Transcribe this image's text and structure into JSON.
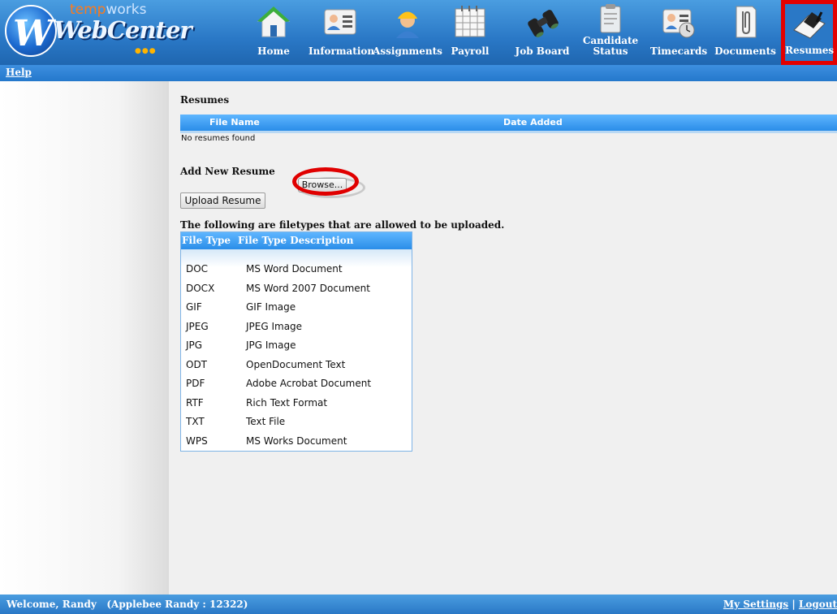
{
  "logo": {
    "brand_top_a": "temp",
    "brand_top_b": "works",
    "brand_main": "WebCenter",
    "badge": "W"
  },
  "nav": [
    {
      "label": "Home",
      "icon": "home-icon"
    },
    {
      "label": "Information",
      "icon": "id-card-icon"
    },
    {
      "label": "Assignments",
      "icon": "worker-icon"
    },
    {
      "label": "Payroll",
      "icon": "calendar-icon"
    },
    {
      "label": "Job Board",
      "icon": "binoculars-icon"
    },
    {
      "label_line1": "Candidate",
      "label_line2": "Status",
      "icon": "clipboard-icon"
    },
    {
      "label": "Timecards",
      "icon": "timecard-icon"
    },
    {
      "label": "Documents",
      "icon": "paperclip-icon"
    },
    {
      "label": "Resumes",
      "icon": "resume-icon",
      "active": true
    }
  ],
  "help_link": "Help",
  "resumes": {
    "title": "Resumes",
    "columns": [
      "File Name",
      "Date Added"
    ],
    "empty_text": "No resumes found"
  },
  "add_resume": {
    "title": "Add New Resume",
    "browse_label": "Browse...",
    "upload_label": "Upload Resume"
  },
  "filetypes": {
    "title": "The following are filetypes that are allowed to be uploaded.",
    "columns": [
      "File Type",
      "File Type Description"
    ],
    "rows": [
      [
        "DOC",
        "MS Word Document"
      ],
      [
        "DOCX",
        "MS Word 2007 Document"
      ],
      [
        "GIF",
        "GIF Image"
      ],
      [
        "JPEG",
        "JPEG Image"
      ],
      [
        "JPG",
        "JPG Image"
      ],
      [
        "ODT",
        "OpenDocument Text"
      ],
      [
        "PDF",
        "Adobe Acrobat Document"
      ],
      [
        "RTF",
        "Rich Text Format"
      ],
      [
        "TXT",
        "Text File"
      ],
      [
        "WPS",
        "MS Works Document"
      ]
    ]
  },
  "footer": {
    "welcome": "Welcome, Randy   (Applebee Randy : 12322)",
    "settings_link": "My Settings",
    "separator": "|",
    "logout_link": "Logout"
  },
  "colors": {
    "header_blue": "#2a78c6",
    "highlight_red": "#e30000",
    "table_head_blue": "#2a8de8"
  }
}
